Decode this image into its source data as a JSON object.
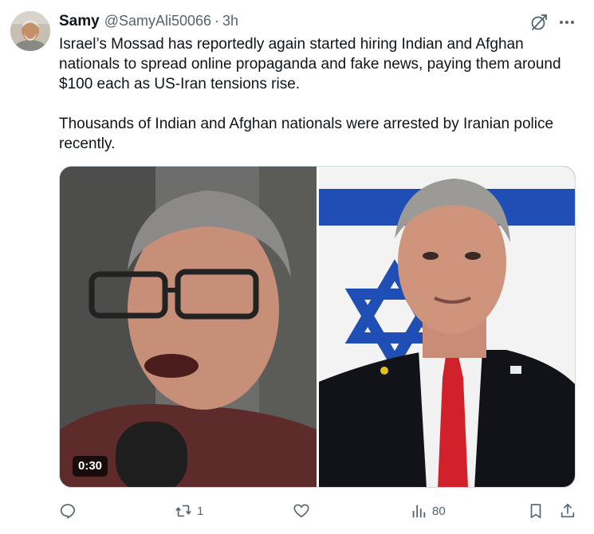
{
  "author": {
    "name": "Samy",
    "handle": "@SamyAli50066",
    "separator": "·",
    "time": "3h"
  },
  "tweet": {
    "paragraphs": [
      "Israel’s Mossad has reportedly again started hiring Indian and Afghan nationals to spread online propaganda and fake news, paying them around $100 each as US-Iran tensions rise.",
      "Thousands of Indian and Afghan nationals were arrested by Iranian police recently."
    ]
  },
  "media": {
    "type": "video",
    "duration": "0:30"
  },
  "actions": {
    "reply_count": "",
    "retweet_count": "1",
    "like_count": "",
    "views_count": "80"
  },
  "icons": {
    "avatar": "profile-photo",
    "grok": "grok-icon",
    "more": "more-icon",
    "reply": "reply-icon",
    "retweet": "retweet-icon",
    "like": "heart-icon",
    "views": "analytics-icon",
    "bookmark": "bookmark-icon",
    "share": "share-icon"
  },
  "colors": {
    "text": "#0f1419",
    "secondary": "#536471",
    "border": "#cfd9de",
    "flag_blue": "#1f4fb5"
  }
}
